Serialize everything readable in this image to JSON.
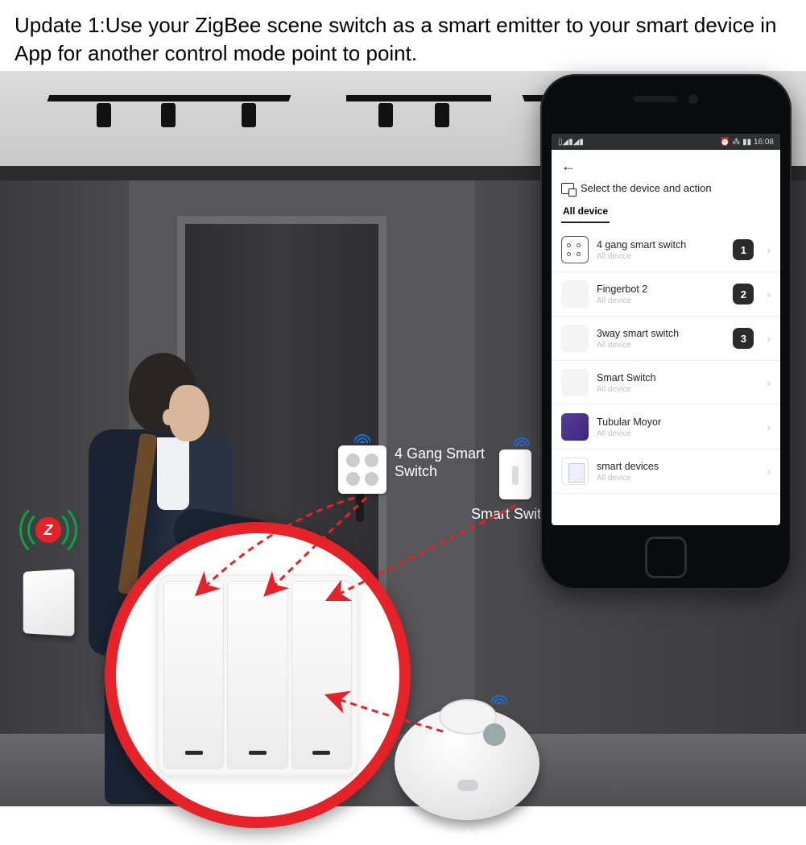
{
  "header_text": "Update 1:Use your ZigBee scene switch as a smart emitter to your smart device in App for another control mode point to point.",
  "labels": {
    "four_gang": "4 Gang Smart\nSwitch",
    "smart_switch": "Smart Switch",
    "robot": "Smart Bluetooth Fingerbot"
  },
  "zigbee_glyph": "Z",
  "phone": {
    "status_left": "▯◢▮◢▮",
    "status_right": "⏰ ⁂ ▮▮ 16:08",
    "select_label": "Select the device and action",
    "tab": "All device",
    "sub": "All device",
    "devices": [
      {
        "title": "4 gang smart switch",
        "badge": "1",
        "icon": "fourg"
      },
      {
        "title": "Fingerbot 2",
        "badge": "2",
        "icon": "plain"
      },
      {
        "title": "3way smart switch",
        "badge": "3",
        "icon": "plain"
      },
      {
        "title": "Smart Switch",
        "badge": "",
        "icon": "plain"
      },
      {
        "title": "Tubular Moyor",
        "badge": "",
        "icon": "purple"
      },
      {
        "title": "smart devices",
        "badge": "",
        "icon": "box3"
      }
    ]
  }
}
